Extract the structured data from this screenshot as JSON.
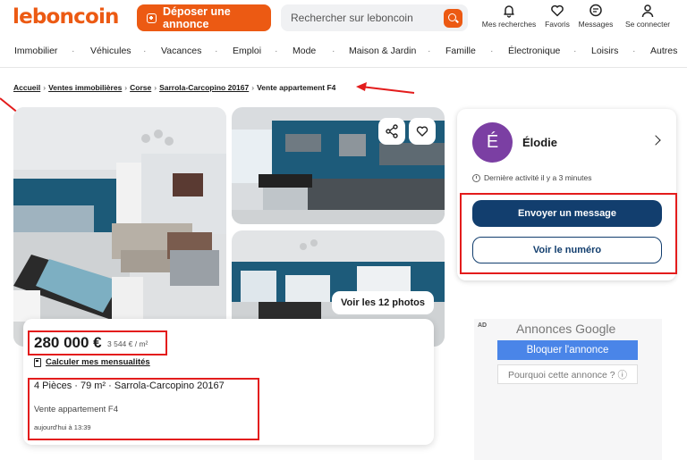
{
  "header": {
    "logo": "leboncoin",
    "post_label": "Déposer une annonce",
    "search_placeholder": "Rechercher sur leboncoin",
    "icons": [
      {
        "name": "bell-icon",
        "label": "Mes recherches"
      },
      {
        "name": "heart-icon",
        "label": "Favoris"
      },
      {
        "name": "message-icon",
        "label": "Messages"
      },
      {
        "name": "user-icon",
        "label": "Se connecter"
      }
    ]
  },
  "nav": [
    "Immobilier",
    "Véhicules",
    "Vacances",
    "Emploi",
    "Mode",
    "Maison & Jardin",
    "Famille",
    "Électronique",
    "Loisirs",
    "Autres"
  ],
  "breadcrumb": {
    "items": [
      "Accueil",
      "Ventes immobilières",
      "Corse",
      "Sarrola-Carcopino 20167"
    ],
    "current": "Vente appartement F4"
  },
  "gallery": {
    "photos_button": "Voir les 12 photos"
  },
  "listing": {
    "price": "280 000 €",
    "price_per_m2": "3 544 € / m²",
    "calc_link": "Calculer mes mensualités",
    "specs": "4 Pièces · 79 m² · Sarrola-Carcopino 20167",
    "title": "Vente appartement F4",
    "date": "aujourd'hui à 13:39"
  },
  "seller": {
    "initial": "É",
    "name": "Élodie",
    "activity": "Dernière activité il y a 3 minutes",
    "message_button": "Envoyer un message",
    "number_button": "Voir le numéro"
  },
  "ad": {
    "label": "AD",
    "title": "Annonces Google",
    "block_button": "Bloquer l'annonce",
    "why_button": "Pourquoi cette annonce ? ⓘ"
  },
  "colors": {
    "brand": "#ec5a13",
    "primary": "#123e6e",
    "avatar": "#7b3fa3",
    "highlight": "#e31c1c"
  }
}
